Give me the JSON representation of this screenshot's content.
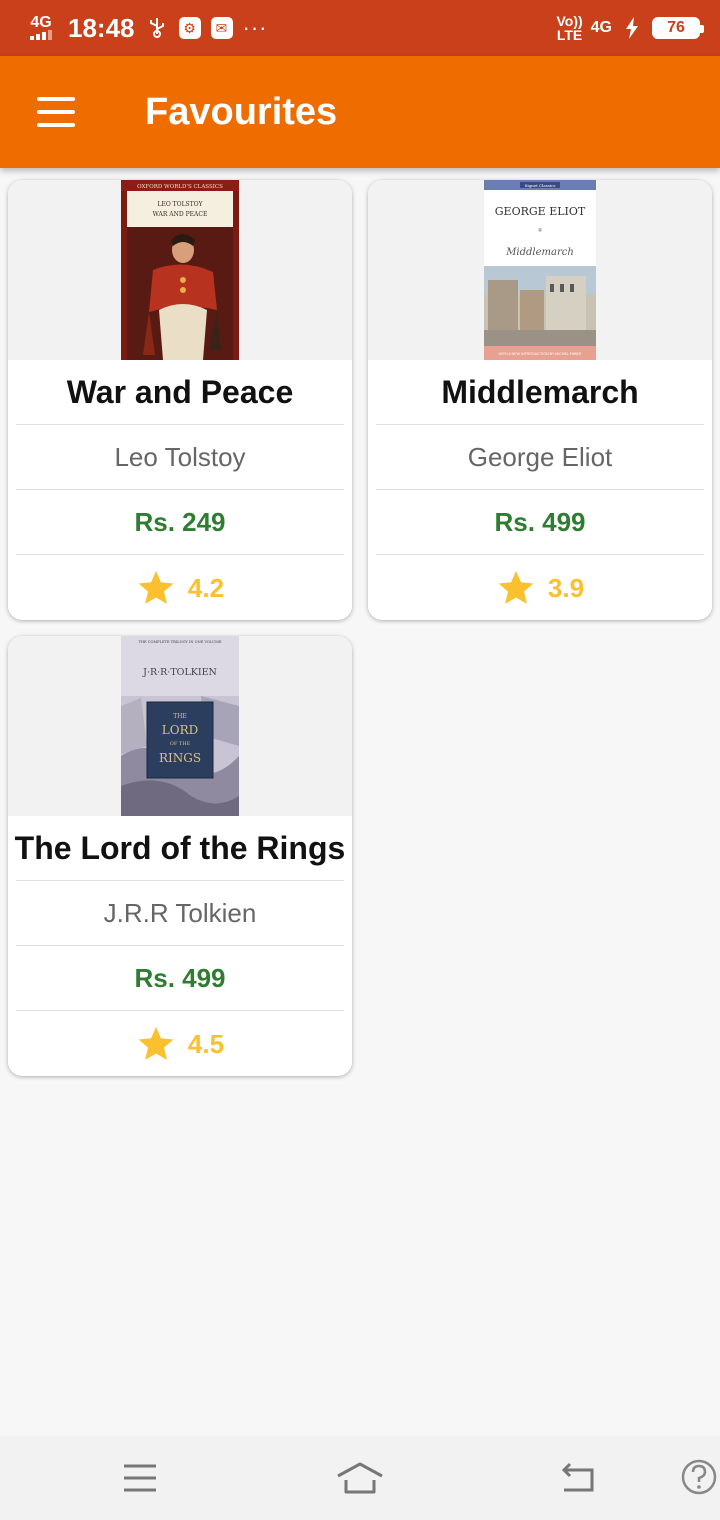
{
  "status_bar": {
    "network": "4G",
    "time": "18:48",
    "volte_top": "Vo))",
    "volte_bottom": "LTE",
    "network_right": "4G",
    "battery": "76"
  },
  "app_bar": {
    "title": "Favourites",
    "menu_icon": "hamburger-menu-icon"
  },
  "books": [
    {
      "title": "War and Peace",
      "author": "Leo Tolstoy",
      "price": "Rs. 249",
      "rating": "4.2",
      "cover": {
        "series": "OXFORD WORLD'S CLASSICS",
        "author": "LEO TOLSTOY",
        "title": "WAR AND PEACE"
      }
    },
    {
      "title": "Middlemarch",
      "author": "George Eliot",
      "price": "Rs. 499",
      "rating": "3.9",
      "cover": {
        "series": "Signet Classics",
        "author": "GEORGE ELIOT",
        "title": "Middlemarch",
        "footer": "WITH A NEW INTRODUCTION BY MICHEL FABER"
      }
    },
    {
      "title": "The Lord of the Rings",
      "author": "J.R.R Tolkien",
      "price": "Rs. 499",
      "rating": "4.5",
      "cover": {
        "top": "THE COMPLETE TRILOGY IN ONE VOLUME",
        "author": "J·R·R·TOLKIEN",
        "title_1": "THE",
        "title_2": "LORD",
        "title_3": "OF THE",
        "title_4": "RINGS"
      }
    }
  ],
  "colors": {
    "status_bar": "#c9401a",
    "app_bar": "#ef6c00",
    "price": "#2e7d32",
    "rating": "#fbc02d"
  },
  "nav_bar": {
    "icons": [
      "menu-icon",
      "home-icon",
      "back-icon",
      "help-icon"
    ]
  }
}
